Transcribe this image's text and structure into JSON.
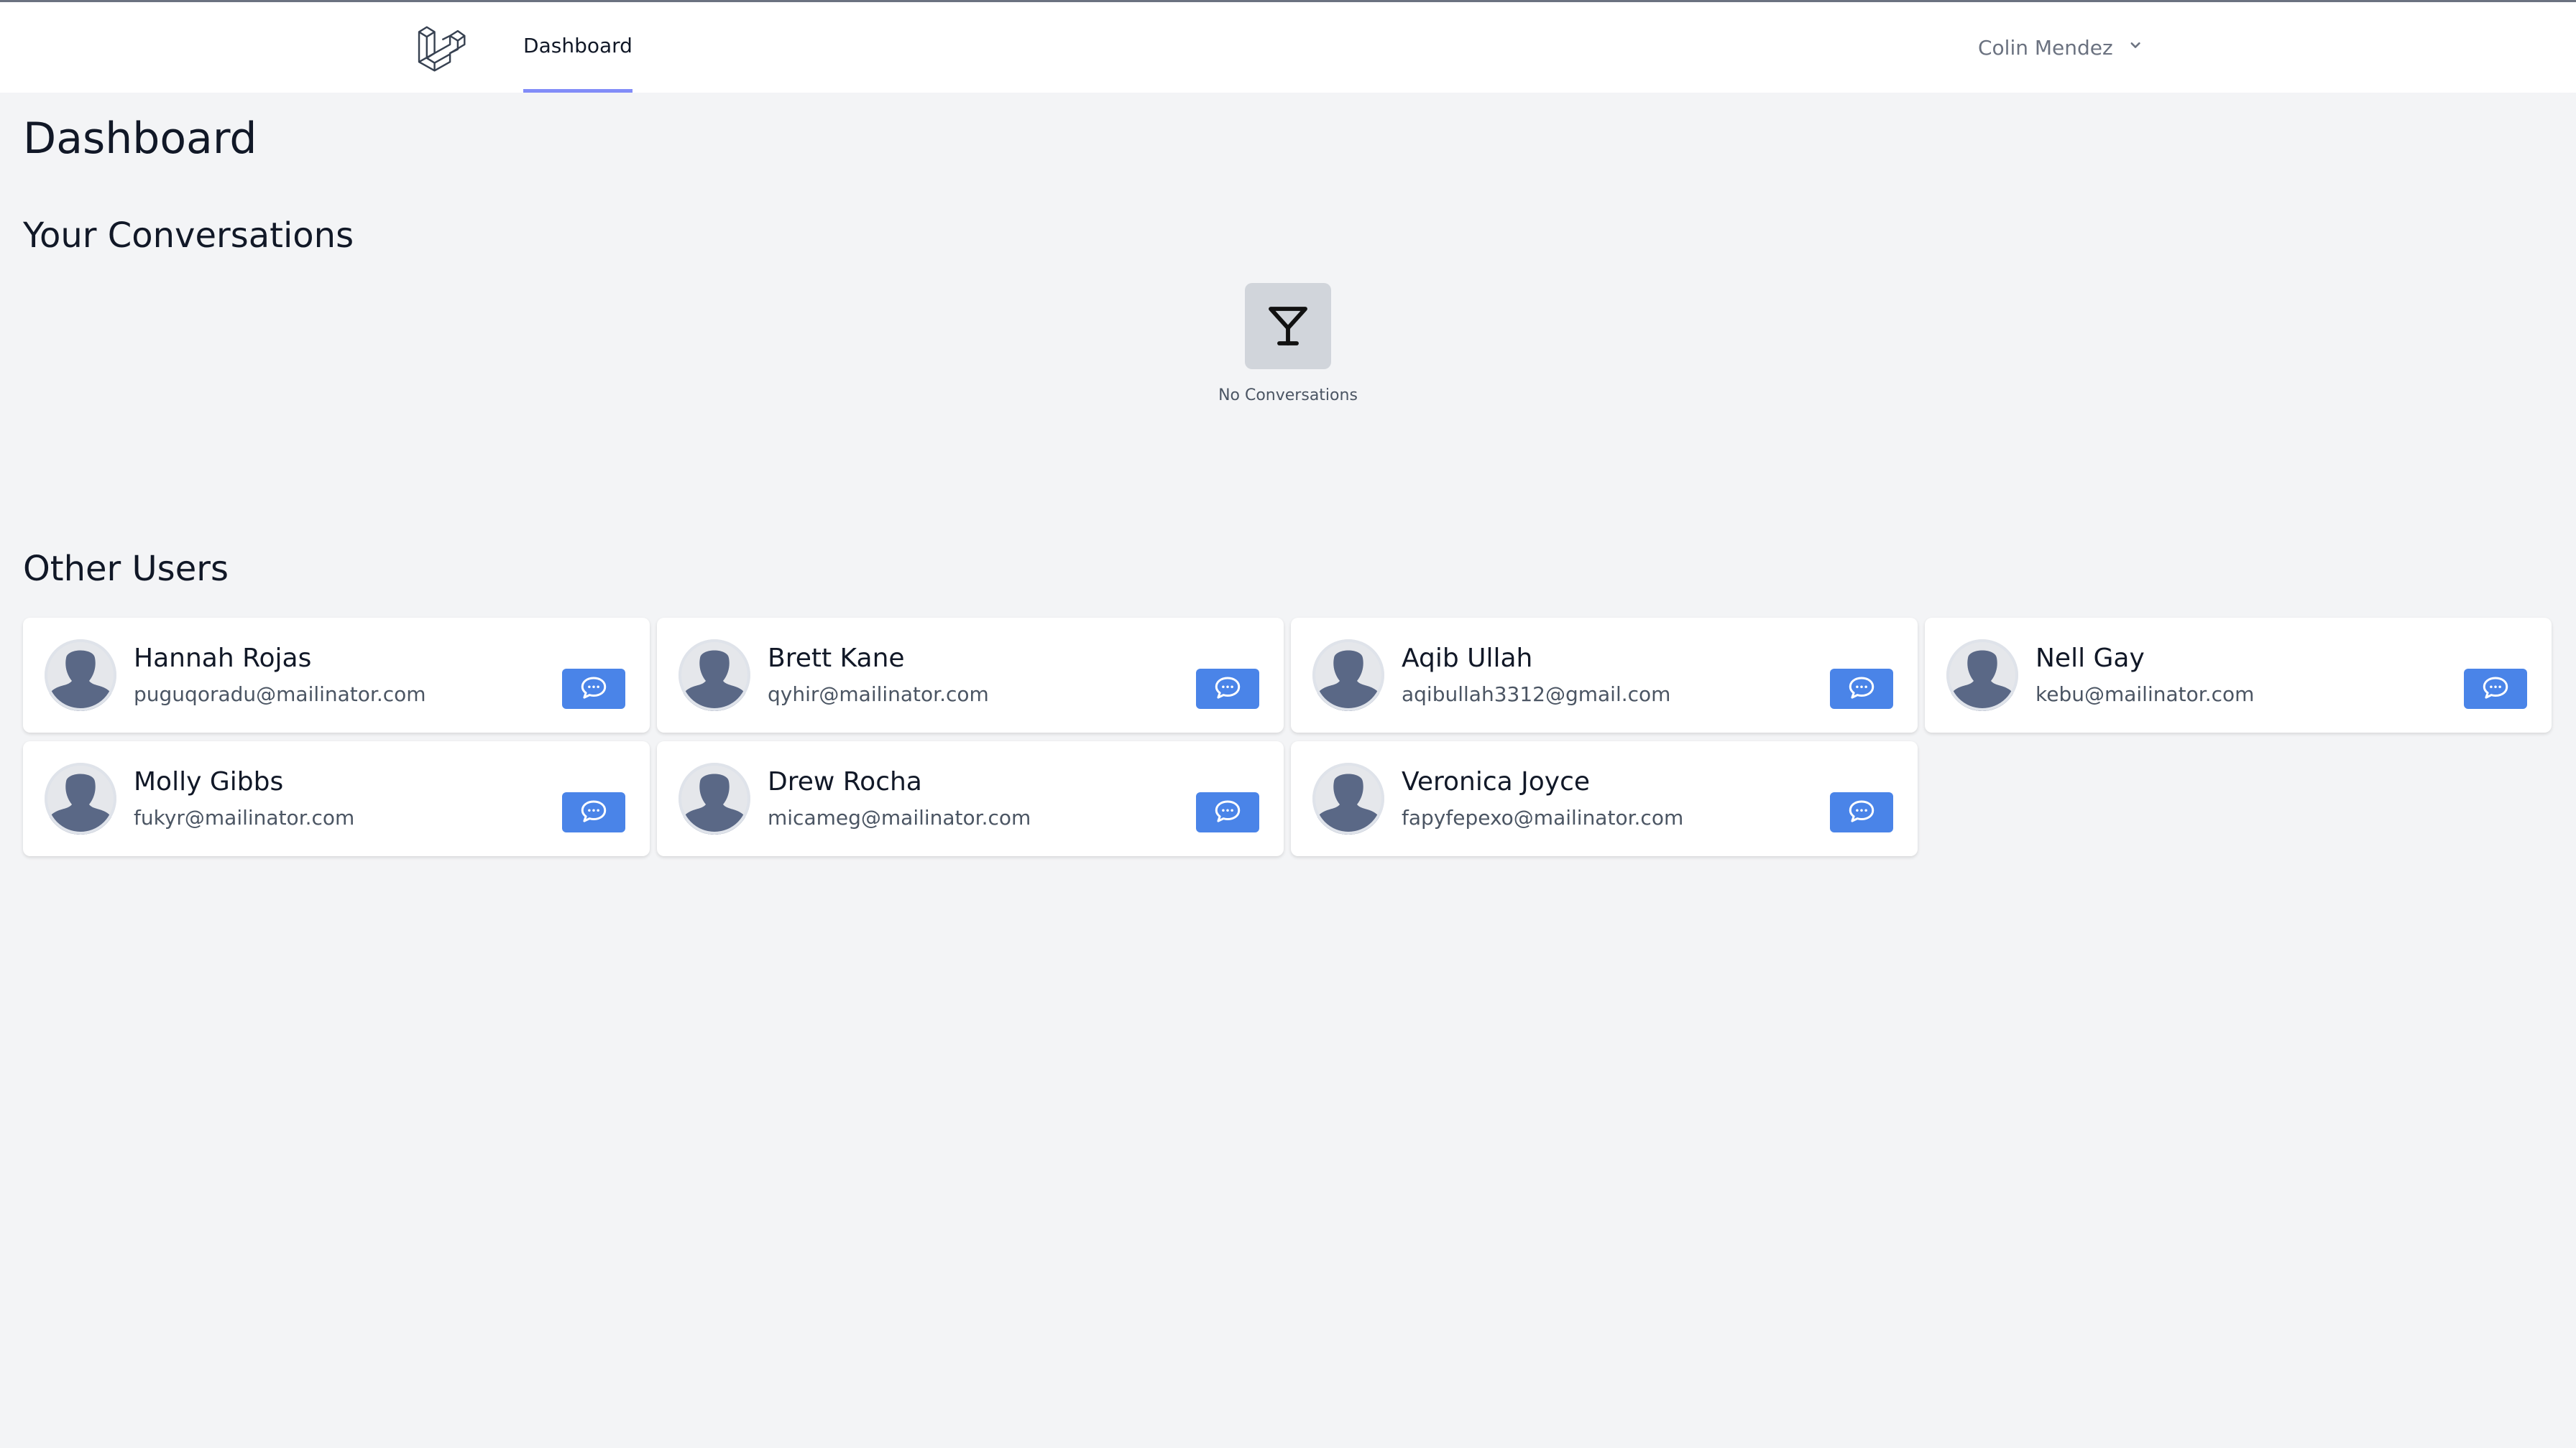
{
  "nav": {
    "logo_icon": "laravel-logo-icon",
    "links": [
      {
        "label": "Dashboard",
        "active": true
      }
    ],
    "user_name": "Colin Mendez",
    "user_menu_icon": "chevron-down-icon"
  },
  "page": {
    "title": "Dashboard"
  },
  "conversations": {
    "title": "Your Conversations",
    "empty_icon": "cocktail-glass-icon",
    "empty_text": "No Conversations"
  },
  "other_users": {
    "title": "Other Users",
    "button_icon": "chat-bubble-icon",
    "users": [
      {
        "name": "Hannah Rojas",
        "email": "puguqoradu@mailinator.com"
      },
      {
        "name": "Brett Kane",
        "email": "qyhir@mailinator.com"
      },
      {
        "name": "Aqib Ullah",
        "email": "aqibullah3312@gmail.com"
      },
      {
        "name": "Nell Gay",
        "email": "kebu@mailinator.com"
      },
      {
        "name": "Molly Gibbs",
        "email": "fukyr@mailinator.com"
      },
      {
        "name": "Drew Rocha",
        "email": "micameg@mailinator.com"
      },
      {
        "name": "Veronica Joyce",
        "email": "fapyfepexo@mailinator.com"
      }
    ]
  },
  "colors": {
    "accent": "#4a84e8",
    "active_underline": "#818cf8",
    "background": "#f3f4f6"
  }
}
